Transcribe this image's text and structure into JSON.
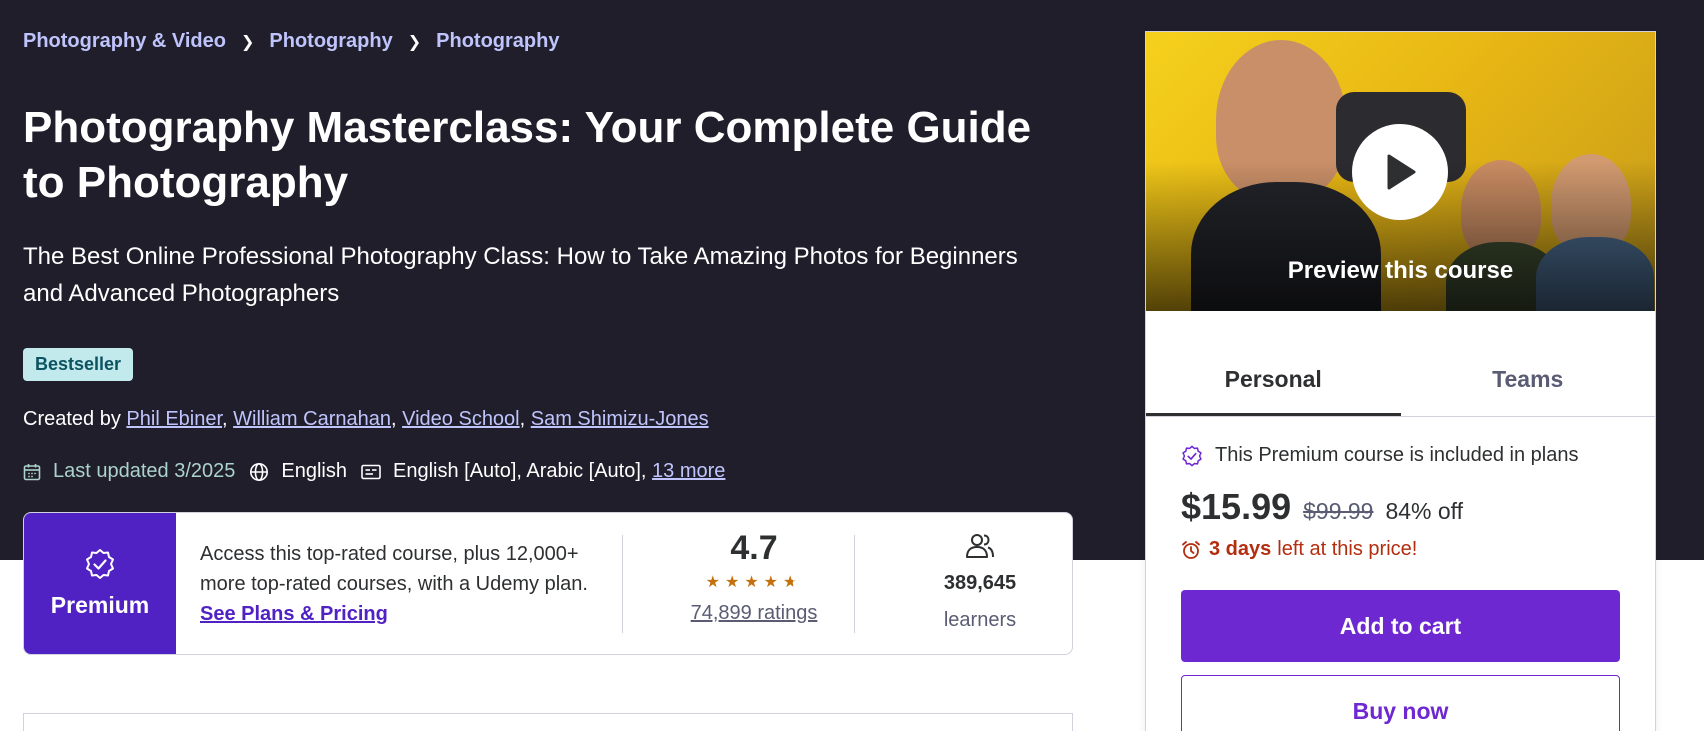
{
  "breadcrumb": [
    "Photography & Video",
    "Photography",
    "Photography"
  ],
  "course": {
    "title": "Photography Masterclass: Your Complete Guide to Photography",
    "subtitle": "The Best Online Professional Photography Class: How to Take Amazing Photos for Beginners and Advanced Photographers",
    "badge": "Bestseller",
    "created_by_label": "Created by",
    "instructors": [
      "Phil Ebiner",
      "William Carnahan",
      "Video School",
      "Sam Shimizu-Jones"
    ],
    "last_updated": "Last updated 3/2025",
    "language": "English",
    "captions": "English [Auto], Arabic [Auto],",
    "captions_more": "13 more"
  },
  "premium": {
    "label": "Premium",
    "text": "Access this top-rated course, plus 12,000+ more top-rated courses, with a Udemy plan.",
    "link": "See Plans & Pricing",
    "rating": "4.7",
    "stars": 4.7,
    "ratings_count": "74,899 ratings",
    "learners_count": "389,645",
    "learners_label": "learners"
  },
  "sidebar": {
    "preview_label": "Preview this course",
    "tabs": [
      "Personal",
      "Teams"
    ],
    "active_tab": "Personal",
    "included_text": "This Premium course is included in plans",
    "price": "$15.99",
    "original_price": "$99.99",
    "discount": "84% off",
    "days_left": "3 days",
    "timer_text": "left at this price!",
    "add_to_cart": "Add to cart",
    "buy_now": "Buy now"
  },
  "colors": {
    "hero_bg": "#1f1e2a",
    "link_light": "#c0c4fc",
    "brand_purple": "#6d28d2",
    "premium_purple": "#5022c3",
    "star": "#c4710d",
    "alert_red": "#b32d0f",
    "badge_bg": "#c2e9eb"
  },
  "icons": [
    "chevron-right-icon",
    "calendar-icon",
    "globe-icon",
    "captions-icon",
    "premium-badge-icon",
    "star-icon",
    "users-icon",
    "play-icon",
    "alarm-icon"
  ]
}
